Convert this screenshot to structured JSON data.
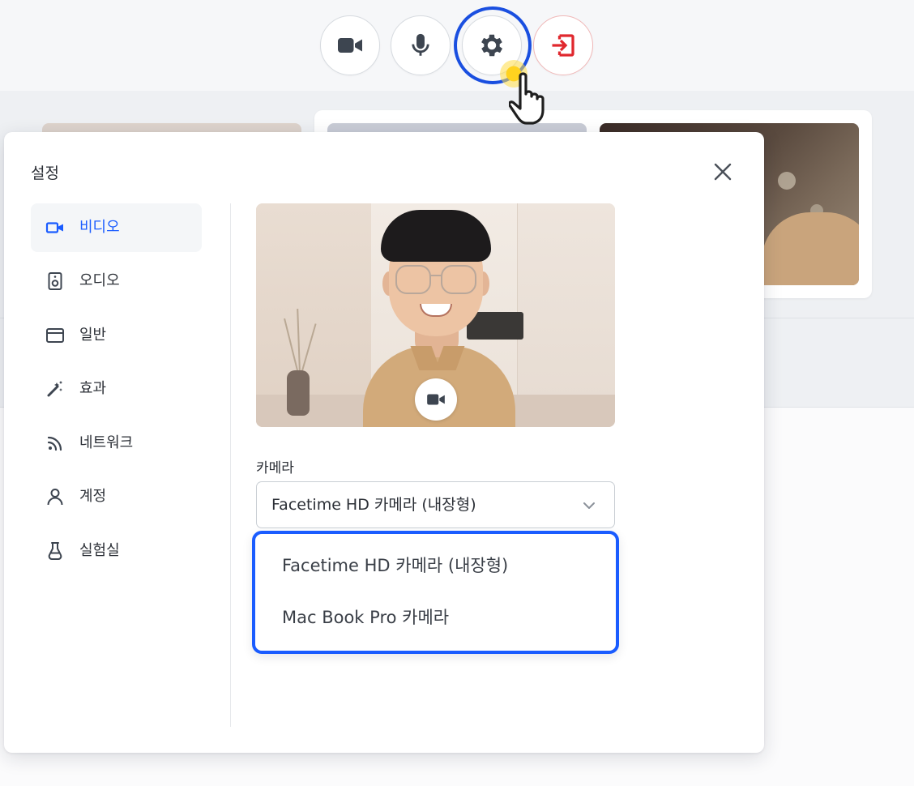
{
  "toolbar": {
    "buttons": [
      {
        "name": "camera",
        "icon": "video-camera-icon"
      },
      {
        "name": "microphone",
        "icon": "microphone-icon"
      },
      {
        "name": "settings",
        "icon": "gear-icon",
        "highlighted": true
      },
      {
        "name": "leave",
        "icon": "exit-icon",
        "color": "#e0282e"
      }
    ]
  },
  "settings_modal": {
    "title": "설정",
    "nav": [
      {
        "label": "비디오",
        "icon": "video-camera-icon",
        "active": true
      },
      {
        "label": "오디오",
        "icon": "speaker-icon"
      },
      {
        "label": "일반",
        "icon": "window-icon"
      },
      {
        "label": "효과",
        "icon": "magic-wand-icon"
      },
      {
        "label": "네트워크",
        "icon": "rss-signal-icon"
      },
      {
        "label": "계정",
        "icon": "user-icon"
      },
      {
        "label": "실험실",
        "icon": "flask-icon"
      }
    ],
    "camera": {
      "label": "카메라",
      "selected": "Facetime HD 카메라 (내장형)",
      "options": [
        "Facetime HD 카메라 (내장형)",
        "Mac Book Pro 카메라"
      ]
    }
  },
  "colors": {
    "accent": "#1a5cff",
    "highlight_ring": "#1a4fe0",
    "danger": "#e0282e",
    "click_indicator": "#ffd21f"
  }
}
